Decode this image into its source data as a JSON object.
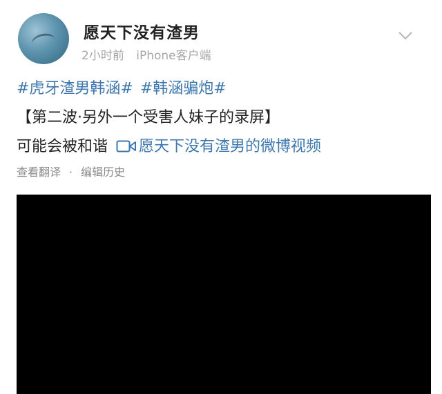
{
  "post": {
    "username": "愿天下没有渣男",
    "time": "2小时前",
    "device": "iPhone客户端",
    "hashtags": [
      "#虎牙渣男韩涵#",
      "#韩涵骗炮#"
    ],
    "line2": "【第二波·另外一个受害人妹子的录屏】",
    "line3_text": "可能会被和谐",
    "video_link_label": "愿天下没有渣男的微博视频",
    "actions": {
      "translate": "查看翻译",
      "separator": "·",
      "edit_history": "编辑历史"
    }
  },
  "colors": {
    "link": "#3e77ad",
    "meta": "#a6a6a6",
    "video_bg": "#000000"
  },
  "icons": {
    "more": "chevron-down-icon",
    "video": "video-camera-icon"
  }
}
